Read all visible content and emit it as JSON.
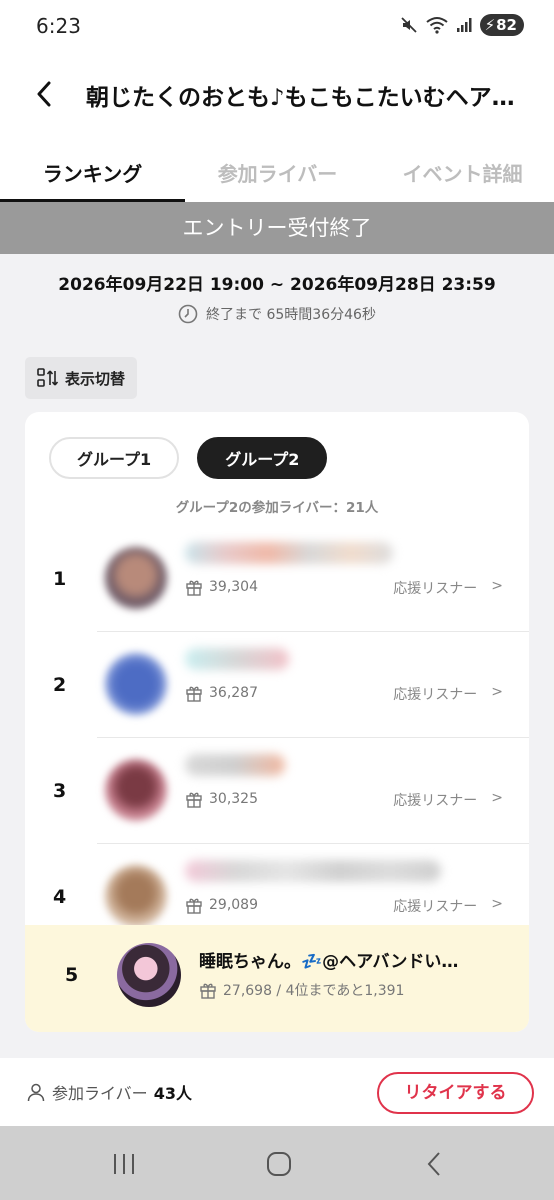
{
  "status_bar": {
    "time": "6:23",
    "battery": "82"
  },
  "header": {
    "title": "朝じたくのおとも♪もこもこたいむヘア…"
  },
  "tabs": [
    {
      "label": "ランキング",
      "active": true
    },
    {
      "label": "参加ライバー",
      "active": false
    },
    {
      "label": "イベント詳細",
      "active": false
    }
  ],
  "banner": {
    "text": "エントリー受付終了"
  },
  "event": {
    "period": "2026年09月22日 19:00 ~ 2026年09月28日 23:59",
    "remaining": "終了まで 65時間36分46秒"
  },
  "view_toggle": {
    "label": "表示切替"
  },
  "groups": [
    {
      "label": "グループ1",
      "active": false
    },
    {
      "label": "グループ2",
      "active": true
    }
  ],
  "group_count": "グループ2の参加ライバー：21人",
  "ranking": [
    {
      "rank": "1",
      "points": "39,304",
      "link": "応援リスナー"
    },
    {
      "rank": "2",
      "points": "36,287",
      "link": "応援リスナー"
    },
    {
      "rank": "3",
      "points": "30,325",
      "link": "応援リスナー"
    },
    {
      "rank": "4",
      "points": "29,089",
      "link": "応援リスナー"
    }
  ],
  "my_rank": {
    "rank": "5",
    "name": "睡眠ちゃん。💤@ヘアバンドい…",
    "points": "27,698 / 4位まであと1,391"
  },
  "footer": {
    "participants_label": "参加ライバー",
    "participants_count": "43人",
    "retire_label": "リタイアする"
  },
  "colors": {
    "accent_red": "#e0334b",
    "banner_grey": "#9a9a9a",
    "highlight": "#fdf7dc"
  }
}
